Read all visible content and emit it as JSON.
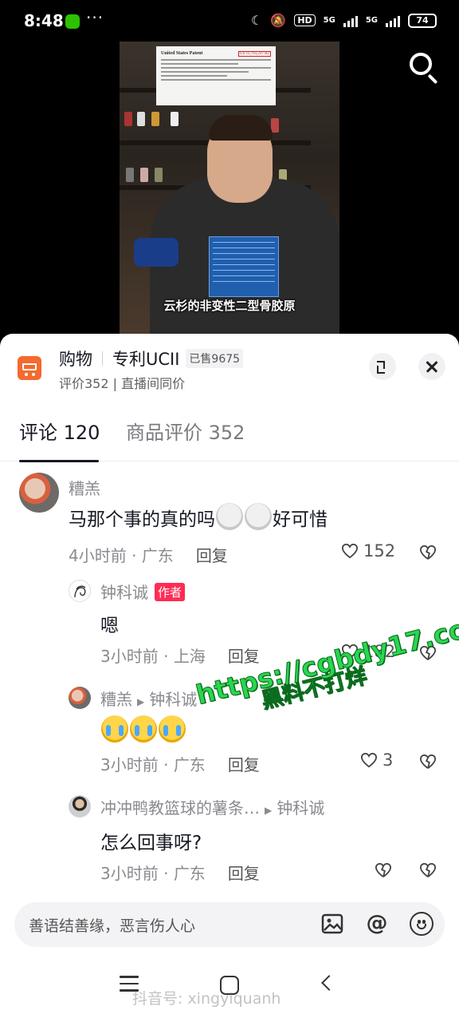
{
  "status_bar": {
    "time": "8:48",
    "more": "···",
    "hd": "HD",
    "net1": "5G",
    "net2": "5G",
    "battery": "74"
  },
  "video": {
    "caption": "云杉的非变性二型骨胶原",
    "patent_title": "United States Patent",
    "patent_number": "US 11,793,237 B2"
  },
  "product": {
    "category": "购物",
    "name": "专利UCII",
    "sold": "已售9675",
    "subtitle": "评价352 | 直播间同价"
  },
  "tabs": [
    {
      "label": "评论 120",
      "active": true
    },
    {
      "label": "商品评价 352",
      "active": false
    }
  ],
  "comments": [
    {
      "name": "糟羔",
      "text_before": "马那个事的真的吗",
      "text_after": "好可惜",
      "time": "4小时前",
      "location": "广东",
      "reply": "回复",
      "likes": "152"
    },
    {
      "name": "钟科诚",
      "tag": "作者",
      "text": "嗯",
      "time": "3小时前",
      "location": "上海",
      "reply": "回复",
      "likes": "182"
    },
    {
      "name": "糟羔",
      "reply_to": "钟科诚",
      "time": "3小时前",
      "location": "广东",
      "reply": "回复",
      "likes": "3"
    },
    {
      "name": "冲冲鸭教篮球的薯条…",
      "reply_to": "钟科诚",
      "text": "怎么回事呀?",
      "time": "3小时前",
      "location": "广东",
      "reply": "回复"
    }
  ],
  "watermark": {
    "line1": "黑料不打烊",
    "line2": "https://cgbdy17.com"
  },
  "input": {
    "placeholder": "善语结善缘，恶言伤人心"
  },
  "nav": {
    "watermark": "抖音号: xingyiquanh"
  },
  "colors": {
    "accent_red": "#fe2c55",
    "shop_orange": "#f56a2e",
    "watermark_green": "#2ad64f"
  },
  "icons": [
    "search-icon",
    "cart-icon",
    "expand-icon",
    "close-icon",
    "heart-icon",
    "dislike-icon",
    "image-icon",
    "at-icon",
    "emoji-icon",
    "menu-icon",
    "home-icon",
    "back-icon"
  ]
}
